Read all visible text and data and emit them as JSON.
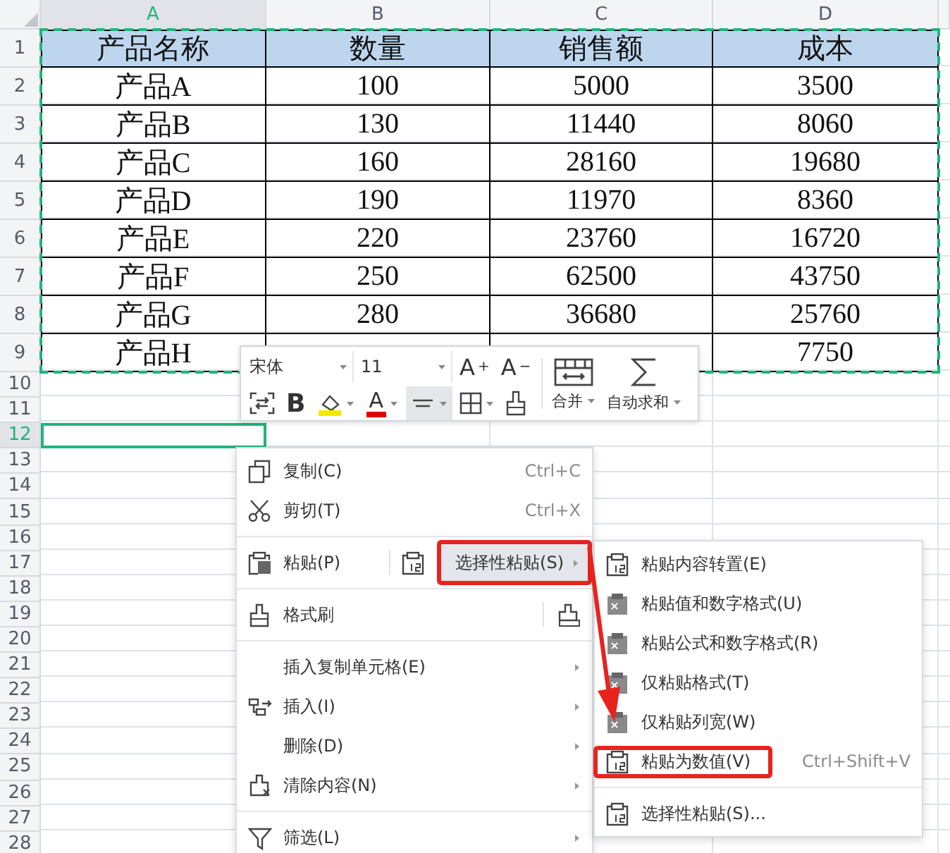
{
  "sheet": {
    "copied": true,
    "columns": [
      {
        "label": "A",
        "selected": true
      },
      {
        "label": "B",
        "selected": false
      },
      {
        "label": "C",
        "selected": false
      },
      {
        "label": "D",
        "selected": false
      }
    ],
    "row_numbers": [
      {
        "label": "1",
        "selected": false
      },
      {
        "label": "2",
        "selected": false
      },
      {
        "label": "3",
        "selected": false
      },
      {
        "label": "4",
        "selected": false
      },
      {
        "label": "5",
        "selected": false
      },
      {
        "label": "6",
        "selected": false
      },
      {
        "label": "7",
        "selected": false
      },
      {
        "label": "8",
        "selected": false
      },
      {
        "label": "9",
        "selected": false
      },
      {
        "label": "10",
        "selected": false
      },
      {
        "label": "11",
        "selected": false
      },
      {
        "label": "12",
        "selected": true
      },
      {
        "label": "13",
        "selected": false
      },
      {
        "label": "14",
        "selected": false
      },
      {
        "label": "15",
        "selected": false
      },
      {
        "label": "16",
        "selected": false
      },
      {
        "label": "17",
        "selected": false
      },
      {
        "label": "18",
        "selected": false
      },
      {
        "label": "19",
        "selected": false
      },
      {
        "label": "20",
        "selected": false
      },
      {
        "label": "21",
        "selected": false
      },
      {
        "label": "22",
        "selected": false
      },
      {
        "label": "23",
        "selected": false
      },
      {
        "label": "24",
        "selected": false
      },
      {
        "label": "25",
        "selected": false
      },
      {
        "label": "26",
        "selected": false
      },
      {
        "label": "27",
        "selected": false
      },
      {
        "label": "28",
        "selected": false
      }
    ],
    "rows": [
      [
        "产品名称",
        "数量",
        "销售额",
        "成本"
      ],
      [
        "产品A",
        "100",
        "5000",
        "3500"
      ],
      [
        "产品B",
        "130",
        "11440",
        "8060"
      ],
      [
        "产品C",
        "160",
        "28160",
        "19680"
      ],
      [
        "产品D",
        "190",
        "11970",
        "8360"
      ],
      [
        "产品E",
        "220",
        "23760",
        "16720"
      ],
      [
        "产品F",
        "250",
        "62500",
        "43750"
      ],
      [
        "产品G",
        "280",
        "36680",
        "25760"
      ],
      [
        "产品H",
        null,
        null,
        "7750"
      ]
    ]
  },
  "mini_toolbar": {
    "font_name": "宋体",
    "font_size": "11",
    "grow_font": "A$^{+}$",
    "shrink_font": "A$^{−}$",
    "bold": "B",
    "font_color": "A",
    "align_selected": true,
    "merge": "合并",
    "autosum": "自动求和"
  },
  "context_menu": {
    "groups": [
      [
        {
          "kind": "command",
          "label": "复制(C)",
          "shortcut": "Ctrl+C",
          "submenu": false
        },
        {
          "kind": "command",
          "label": "剪切(T)",
          "shortcut": "Ctrl+X",
          "submenu": false
        }
      ],
      [
        {
          "kind": "split",
          "label": "粘贴(P)",
          "side_label": "选择性粘贴(S)",
          "side_selected": true,
          "side_highlighted": true
        }
      ],
      [
        {
          "kind": "tool",
          "label": "格式刷"
        }
      ],
      [
        {
          "kind": "command",
          "label": "插入复制单元格(E)",
          "submenu": true
        },
        {
          "kind": "command",
          "label": "插入(I)",
          "submenu": true
        },
        {
          "kind": "command",
          "label": "删除(D)",
          "submenu": true
        },
        {
          "kind": "command",
          "label": "清除内容(N)",
          "submenu": true
        }
      ],
      [
        {
          "kind": "command",
          "label": "筛选(L)",
          "submenu": true
        }
      ]
    ]
  },
  "paste_submenu": {
    "groups": [
      [
        {
          "label": "粘贴内容转置(E)",
          "highlighted": false
        },
        {
          "label": "粘贴值和数字格式(U)",
          "highlighted": false
        },
        {
          "label": "粘贴公式和数字格式(R)",
          "highlighted": false
        },
        {
          "label": "仅粘贴格式(T)",
          "highlighted": false
        },
        {
          "label": "仅粘贴列宽(W)",
          "highlighted": false
        },
        {
          "label": "粘贴为数值(V)",
          "shortcut": "Ctrl+Shift+V",
          "highlighted": true
        }
      ],
      [
        {
          "label": "选择性粘贴(S)...",
          "highlighted": false
        }
      ]
    ]
  },
  "pointer_arrow": true
}
